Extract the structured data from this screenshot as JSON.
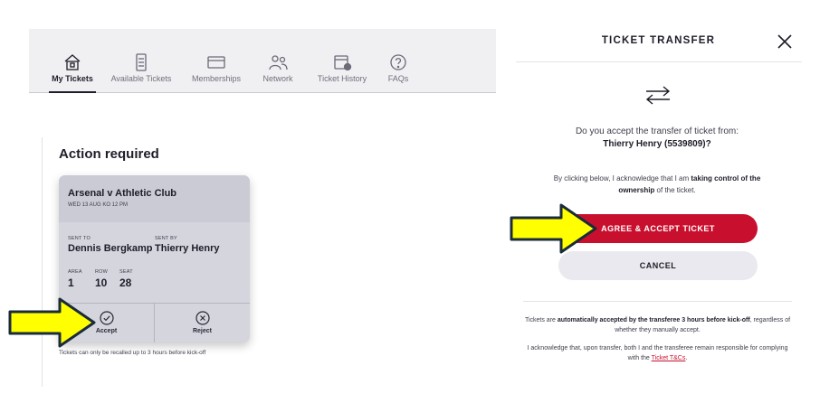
{
  "nav": {
    "items": [
      {
        "label": "My Tickets",
        "icon": "home-ticket-icon"
      },
      {
        "label": "Available Tickets",
        "icon": "ticket-stub-icon"
      },
      {
        "label": "Memberships",
        "icon": "card-icon"
      },
      {
        "label": "Network",
        "icon": "people-icon"
      },
      {
        "label": "Ticket History",
        "icon": "calendar-history-icon"
      },
      {
        "label": "FAQs",
        "icon": "question-icon"
      }
    ],
    "active": "My Tickets"
  },
  "action": {
    "title": "Action required",
    "ticket": {
      "match": "Arsenal v Athletic Club",
      "kickoff": "WED 13 AUG  KO 12 PM",
      "sent_to_label": "SENT TO",
      "sent_to": "Dennis Bergkamp",
      "sent_by_label": "SENT BY",
      "sent_by": "Thierry Henry",
      "area_label": "AREA",
      "area": "1",
      "row_label": "ROW",
      "row": "10",
      "seat_label": "SEAT",
      "seat": "28",
      "accept_label": "Accept",
      "reject_label": "Reject"
    },
    "recall_note": "Tickets can only be recalled up to 3 hours before kick-off"
  },
  "modal": {
    "title": "TICKET TRANSFER",
    "question": "Do you accept the transfer of ticket from:",
    "from": "Thierry Henry (5539809)?",
    "ack_prefix": "By clicking below, I acknowledge that I am ",
    "ack_bold1": "taking control of the",
    "ack_bold2": "ownership",
    "ack_suffix": " of the ticket.",
    "agree_label": "AGREE & ACCEPT TICKET",
    "cancel_label": "CANCEL",
    "fine1_prefix": "Tickets are ",
    "fine1_bold": "automatically accepted by the transferee 3 hours before kick-off",
    "fine1_suffix": ", regardless of whether they manually accept.",
    "fine2_text": "I acknowledge that, upon transfer, both I and the transferee remain responsible for complying with the ",
    "fine2_link": "Ticket T&Cs",
    "fine2_end": "."
  },
  "colors": {
    "brand_red": "#c8102e",
    "arrow_yellow": "#ffff00",
    "arrow_outline": "#1a2b3a"
  }
}
